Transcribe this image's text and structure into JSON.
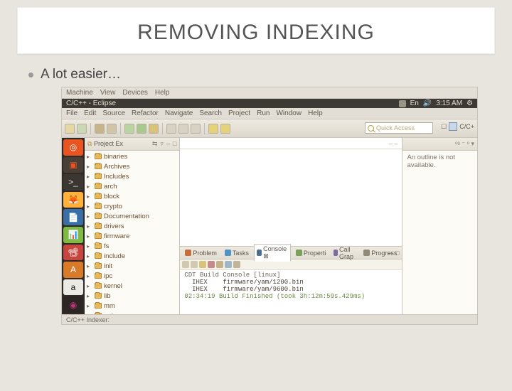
{
  "slide": {
    "title": "REMOVING INDEXING",
    "bullet": "A lot easier…"
  },
  "vm_menubar": [
    "Machine",
    "View",
    "Devices",
    "Help"
  ],
  "topbar": {
    "title": "C/C++ - Eclipse",
    "lang": "En",
    "time": "3:15 AM"
  },
  "eclipse_menubar": [
    "File",
    "Edit",
    "Source",
    "Refactor",
    "Navigate",
    "Search",
    "Project",
    "Run",
    "Window",
    "Help"
  ],
  "quick_access_placeholder": "Quick Access",
  "perspective": {
    "open_label": "☐",
    "cpp_label": "C/C+"
  },
  "launcher": [
    {
      "bg": "#e95420",
      "fg": "#fff",
      "glyph": "◎"
    },
    {
      "bg": "#4a3f36",
      "fg": "#e95420",
      "glyph": "▣"
    },
    {
      "bg": "#3b3631",
      "fg": "#ddd",
      "glyph": ">_"
    },
    {
      "bg": "#ffb13b",
      "fg": "#1a5fb4",
      "glyph": "🦊"
    },
    {
      "bg": "#3a6ea5",
      "fg": "#fff",
      "glyph": "📄"
    },
    {
      "bg": "#7fba42",
      "fg": "#fff",
      "glyph": "📊"
    },
    {
      "bg": "#c7453e",
      "fg": "#fff",
      "glyph": "📽"
    },
    {
      "bg": "#d97a29",
      "fg": "#fff",
      "glyph": "A"
    },
    {
      "bg": "#eceae4",
      "fg": "#111",
      "glyph": "a"
    },
    {
      "bg": "#2b2623",
      "fg": "#b37",
      "glyph": "◉"
    }
  ],
  "project_explorer": {
    "title": "Project Ex",
    "items": [
      {
        "label": "binaries"
      },
      {
        "label": "Archives"
      },
      {
        "label": "Includes"
      },
      {
        "label": "arch"
      },
      {
        "label": "block"
      },
      {
        "label": "crypto"
      },
      {
        "label": "Documentation"
      },
      {
        "label": "drivers"
      },
      {
        "label": "firmware"
      },
      {
        "label": "fs"
      },
      {
        "label": "include"
      },
      {
        "label": "init"
      },
      {
        "label": "ipc"
      },
      {
        "label": "kernel"
      },
      {
        "label": "lib"
      },
      {
        "label": "mm"
      },
      {
        "label": "net"
      }
    ]
  },
  "outline": {
    "header_glyphs": "ᵒᵍ  ⁻ ᵒ ▾",
    "text": "An outline is not available."
  },
  "bottom_panel": {
    "tabs": [
      {
        "label": "Problem",
        "icon": "#c46f3b"
      },
      {
        "label": "Tasks",
        "icon": "#4f92c6"
      },
      {
        "label": "Console ⊠",
        "icon": "#4f6f8f",
        "active": true
      },
      {
        "label": "Properti",
        "icon": "#7aa05a"
      },
      {
        "label": "Call Grap",
        "icon": "#7a6ca0"
      },
      {
        "label": "Progress",
        "icon": "#8f8978"
      }
    ],
    "console_title": "CDT Build Console [linux]",
    "lines": [
      "  IHEX    firmware/yam/1200.bin",
      "  IHEX    firmware/yam/9600.bin",
      "",
      "02:34:19 Build Finished (took 3h:12m:59s.429ms)"
    ]
  },
  "statusbar": "C/C++ Indexer:"
}
